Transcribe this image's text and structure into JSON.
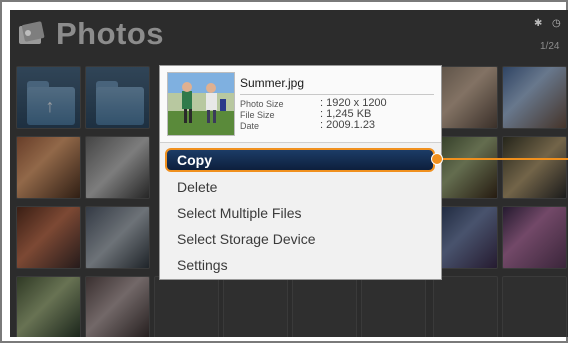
{
  "app": {
    "title": "Photos",
    "page_indicator": "1/24"
  },
  "header_icon": "photo-icon",
  "status": {
    "bluetooth": "bluetooth-icon",
    "clock": "clock-icon"
  },
  "file_info": {
    "name": "Summer.jpg",
    "photo_size_label": "Photo Size",
    "photo_size_value": ": 1920 x 1200",
    "file_size_label": "File Size",
    "file_size_value": ": 1,245 KB",
    "date_label": "Date",
    "date_value": ": 2009.1.23"
  },
  "menu": {
    "items": [
      "Copy",
      "Delete",
      "Select Multiple Files",
      "Select Storage Device",
      "Settings"
    ],
    "selected": "Copy"
  },
  "colors": {
    "highlight_border": "#f0901e",
    "selected_bg": "#13294b",
    "screen_bg": "#2c2c2c",
    "popup_bg": "#f1f1f1"
  }
}
